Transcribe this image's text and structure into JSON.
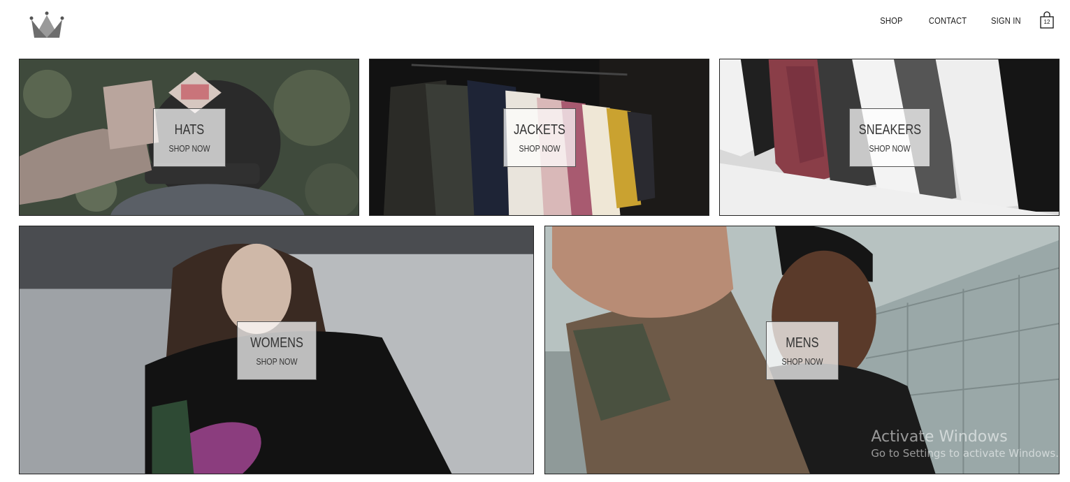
{
  "header": {
    "logo_icon": "crown-icon",
    "nav": [
      {
        "label": "SHOP"
      },
      {
        "label": "CONTACT"
      },
      {
        "label": "SIGN IN"
      }
    ],
    "cart": {
      "icon": "shopping-bag-icon",
      "count": "12"
    }
  },
  "categories": [
    {
      "title": "HATS",
      "cta": "SHOP NOW"
    },
    {
      "title": "JACKETS",
      "cta": "SHOP NOW"
    },
    {
      "title": "SNEAKERS",
      "cta": "SHOP NOW"
    },
    {
      "title": "WOMENS",
      "cta": "SHOP NOW"
    },
    {
      "title": "MENS",
      "cta": "SHOP NOW"
    }
  ],
  "watermark": {
    "title": "Activate Windows",
    "subtitle": "Go to Settings to activate Windows."
  }
}
